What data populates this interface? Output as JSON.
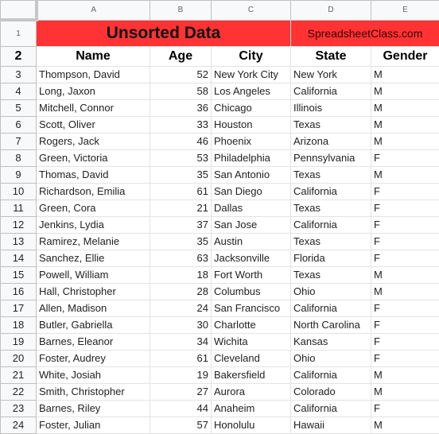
{
  "column_headers": [
    "A",
    "B",
    "C",
    "D",
    "E"
  ],
  "title": "Unsorted Data",
  "brand": "SpreadsheetClass.com",
  "colors": {
    "title_band": "#ff3333"
  },
  "row_numbers": [
    "1",
    "2",
    "3",
    "4",
    "5",
    "6",
    "7",
    "8",
    "9",
    "10",
    "11",
    "12",
    "13",
    "14",
    "15",
    "16",
    "17",
    "18",
    "19",
    "20",
    "21",
    "22",
    "23",
    "24"
  ],
  "headers": [
    "Name",
    "Age",
    "City",
    "State",
    "Gender"
  ],
  "rows": [
    [
      "Thompson, David",
      "52",
      "New York City",
      "New York",
      "M"
    ],
    [
      "Long, Jaxon",
      "58",
      "Los Angeles",
      "California",
      "M"
    ],
    [
      "Mitchell, Connor",
      "36",
      "Chicago",
      "Illinois",
      "M"
    ],
    [
      "Scott, Oliver",
      "33",
      "Houston",
      "Texas",
      "M"
    ],
    [
      "Rogers, Jack",
      "46",
      "Phoenix",
      "Arizona",
      "M"
    ],
    [
      "Green, Victoria",
      "53",
      "Philadelphia",
      "Pennsylvania",
      "F"
    ],
    [
      "Thomas, David",
      "35",
      "San Antonio",
      "Texas",
      "M"
    ],
    [
      "Richardson, Emilia",
      "61",
      "San Diego",
      "California",
      "F"
    ],
    [
      "Green, Cora",
      "21",
      "Dallas",
      "Texas",
      "F"
    ],
    [
      "Jenkins, Lydia",
      "37",
      "San Jose",
      "California",
      "F"
    ],
    [
      "Ramirez, Melanie",
      "35",
      "Austin",
      "Texas",
      "F"
    ],
    [
      "Sanchez, Ellie",
      "63",
      "Jacksonville",
      "Florida",
      "F"
    ],
    [
      "Powell, William",
      "18",
      "Fort Worth",
      "Texas",
      "M"
    ],
    [
      "Hall, Christopher",
      "28",
      "Columbus",
      "Ohio",
      "M"
    ],
    [
      "Allen, Madison",
      "24",
      "San Francisco",
      "California",
      "F"
    ],
    [
      "Butler, Gabriella",
      "30",
      "Charlotte",
      "North Carolina",
      "F"
    ],
    [
      "Barnes, Eleanor",
      "34",
      "Wichita",
      "Kansas",
      "F"
    ],
    [
      "Foster, Audrey",
      "61",
      "Cleveland",
      "Ohio",
      "F"
    ],
    [
      "White, Josiah",
      "19",
      "Bakersfield",
      "California",
      "M"
    ],
    [
      "Smith, Christopher",
      "27",
      "Aurora",
      "Colorado",
      "M"
    ],
    [
      "Barnes, Riley",
      "44",
      "Anaheim",
      "California",
      "F"
    ],
    [
      "Foster, Julian",
      "57",
      "Honolulu",
      "Hawaii",
      "M"
    ]
  ]
}
